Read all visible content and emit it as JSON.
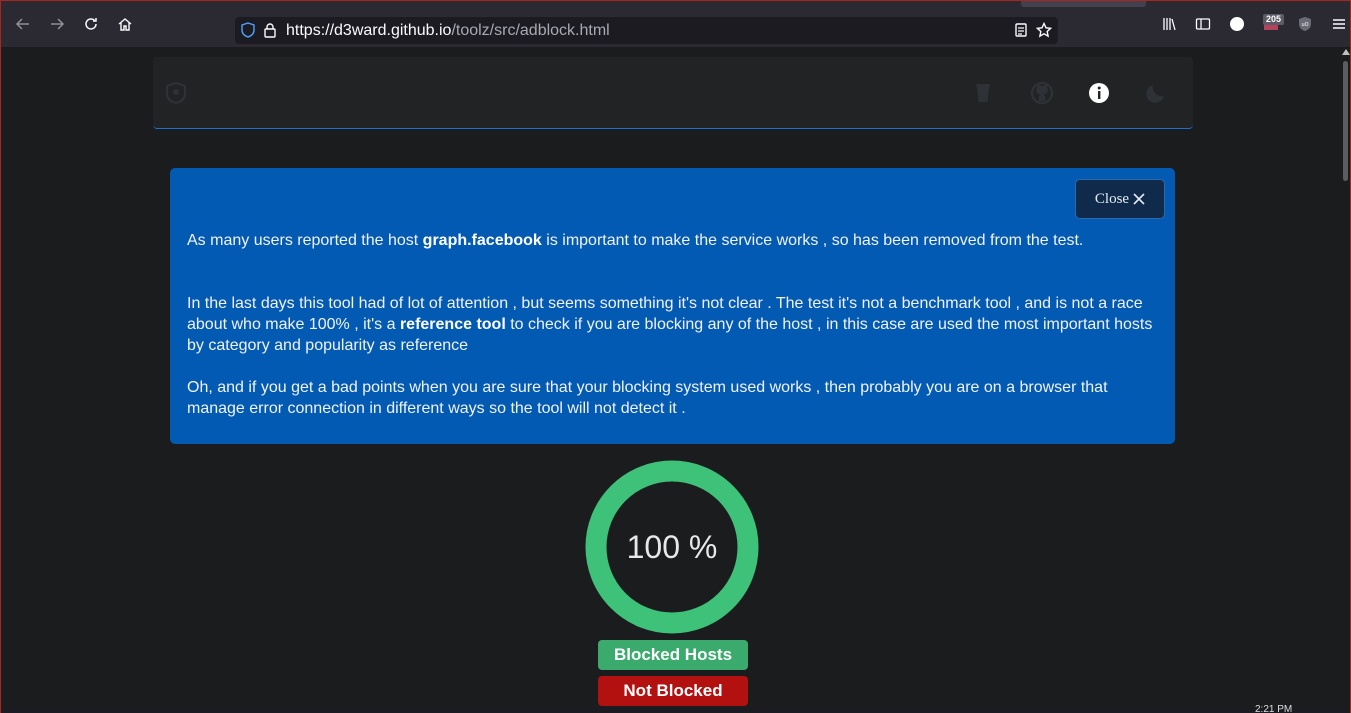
{
  "browser": {
    "url_host": "https://d3ward.github.io",
    "url_path": "/toolz/src/adblock.html",
    "extension_badge": "205"
  },
  "notice": {
    "close_label": "Close",
    "p1_pre": "As many users reported the host ",
    "p1_bold": "graph.facebook",
    "p1_post": " is important to make the service works , so has been removed from the test.",
    "p2_pre": "In the last days this tool had of lot of attention , but seems something it's not clear . The test it's not a benchmark tool , and is not a race about who make 100% , it's a ",
    "p2_bold": "reference tool",
    "p2_post": " to check if you are blocking any of the host , in this case are used the most important hosts by category and popularity as reference",
    "p3": "Oh, and if you get a bad points when you are sure that your blocking system used works , then probably you are on a browser that manage error connection in different ways so the tool will not detect it ."
  },
  "result": {
    "percent_label": "100 %",
    "blocked_fraction": 1.0,
    "blocked_label": "Blocked Hosts",
    "not_blocked_label": "Not Blocked"
  },
  "colors": {
    "blocked": "#3ec178",
    "notice_bg": "#035ab3",
    "not_blocked": "#b31010"
  },
  "clock_partial": "2:21 PM"
}
